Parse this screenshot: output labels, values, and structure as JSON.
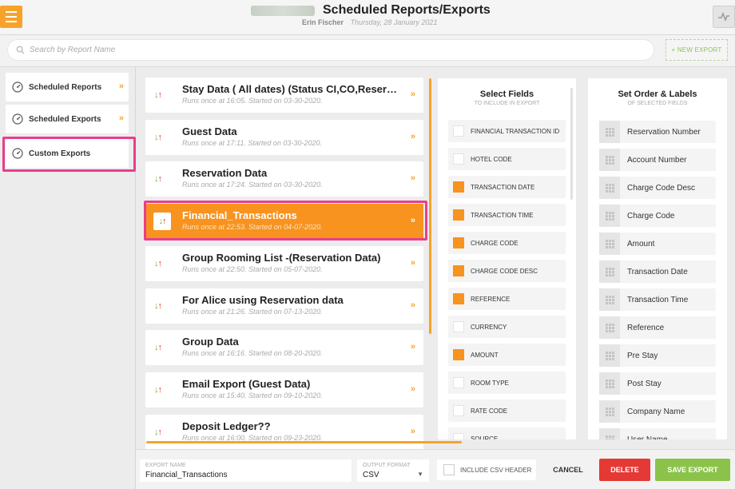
{
  "header": {
    "title": "Scheduled Reports/Exports",
    "user": "Erin Fischer",
    "date": "Thursday, 28 January 2021",
    "menu_icon": "hamburger-icon",
    "activity_icon": "activity-icon"
  },
  "search": {
    "placeholder": "Search by Report Name",
    "new_export_label": "+ NEW EXPORT"
  },
  "sidebar": {
    "items": [
      {
        "label": "Scheduled Reports",
        "icon": "gauge-icon",
        "chevron": "»"
      },
      {
        "label": "Scheduled Exports",
        "icon": "gauge-icon",
        "chevron": "»"
      },
      {
        "label": "Custom Exports",
        "icon": "gauge-icon"
      }
    ],
    "active": "Custom Exports"
  },
  "reports": [
    {
      "name": "Stay Data ( All dates) (Status CI,CO,Reservations)",
      "schedule": "Runs once at 16:05. Started on 03-30-2020."
    },
    {
      "name": "Guest Data",
      "schedule": "Runs once at 17:11. Started on 03-30-2020."
    },
    {
      "name": "Reservation Data",
      "schedule": "Runs once at 17:24. Started on 03-30-2020."
    },
    {
      "name": "Financial_Transactions",
      "schedule": "Runs once at 22:53. Started on 04-07-2020."
    },
    {
      "name": "Group Rooming List -(Reservation Data)",
      "schedule": "Runs once at 22:50. Started on 05-07-2020."
    },
    {
      "name": "For Alice using Reservation data",
      "schedule": "Runs once at 21:26. Started on 07-13-2020."
    },
    {
      "name": "Group Data",
      "schedule": "Runs once at 16:16. Started on 08-20-2020."
    },
    {
      "name": "Email Export (Guest Data)",
      "schedule": "Runs once at 15:40. Started on 09-10-2020."
    },
    {
      "name": "Deposit Ledger??",
      "schedule": "Runs once at 16:00. Started on 09-23-2020."
    }
  ],
  "reports_chevron": "»",
  "arrow_down": "↓",
  "arrow_up": "↑",
  "select_fields": {
    "title": "Select Fields",
    "subtitle": "TO INCLUDE IN EXPORT",
    "items": [
      {
        "label": "FINANCIAL TRANSACTION ID",
        "checked": false
      },
      {
        "label": "HOTEL CODE",
        "checked": false
      },
      {
        "label": "TRANSACTION DATE",
        "checked": true
      },
      {
        "label": "TRANSACTION TIME",
        "checked": true
      },
      {
        "label": "CHARGE CODE",
        "checked": true
      },
      {
        "label": "CHARGE CODE DESC",
        "checked": true
      },
      {
        "label": "REFERENCE",
        "checked": true
      },
      {
        "label": "CURRENCY",
        "checked": false
      },
      {
        "label": "AMOUNT",
        "checked": true
      },
      {
        "label": "ROOM TYPE",
        "checked": false
      },
      {
        "label": "RATE CODE",
        "checked": false
      },
      {
        "label": "SOURCE",
        "checked": false
      }
    ]
  },
  "order_labels": {
    "title": "Set Order & Labels",
    "subtitle": "OF SELECTED FIELDS",
    "items": [
      "Reservation Number",
      "Account Number",
      "Charge Code Desc",
      "Charge Code",
      "Amount",
      "Transaction Date",
      "Transaction Time",
      "Reference",
      "Pre Stay",
      "Post Stay",
      "Company Name",
      "User Name"
    ]
  },
  "footer": {
    "export_name_label": "EXPORT NAME",
    "export_name_value": "Financial_Transactions",
    "output_format_label": "OUTPUT FORMAT",
    "output_format_value": "CSV",
    "include_csv_header_label": "INCLUDE CSV HEADER",
    "cancel_label": "CANCEL",
    "delete_label": "DELETE",
    "save_label": "SAVE EXPORT"
  },
  "colors": {
    "accent": "#f7931e",
    "highlight": "#e83e8c",
    "delete": "#e53935",
    "save": "#8bc34a"
  }
}
